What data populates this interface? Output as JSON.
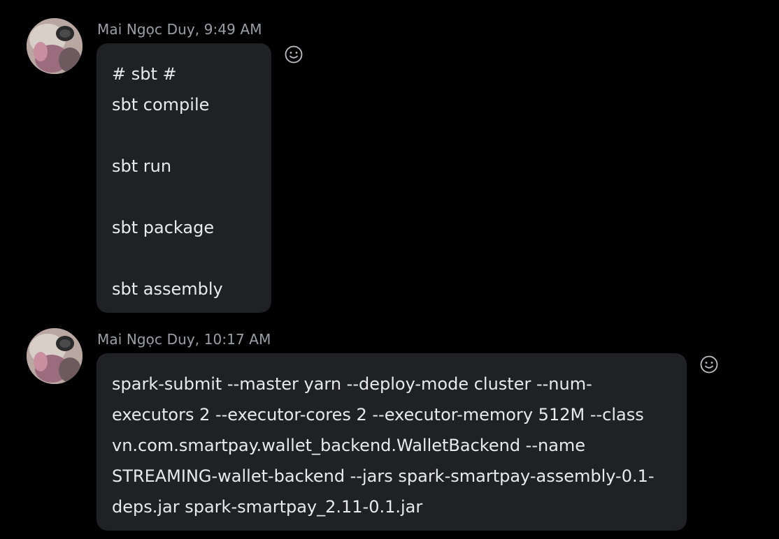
{
  "messages": [
    {
      "sender": "Mai Ngọc Duy",
      "time": "9:49 AM",
      "meta": "Mai Ngọc Duy, 9:49 AM",
      "lines": [
        "# sbt #",
        "sbt compile",
        "",
        "sbt run",
        "",
        "sbt package",
        "",
        "sbt assembly"
      ]
    },
    {
      "sender": "Mai Ngọc Duy",
      "time": "10:17 AM",
      "meta": "Mai Ngọc Duy, 10:17 AM",
      "lines": [
        "spark-submit --master yarn --deploy-mode cluster --num-",
        "executors 2 --executor-cores 2 --executor-memory 512M --class",
        "vn.com.smartpay.wallet_backend.WalletBackend --name",
        "STREAMING-wallet-backend --jars spark-smartpay-assembly-0.1-",
        "deps.jar spark-smartpay_2.11-0.1.jar"
      ]
    }
  ],
  "icons": {
    "reaction": "smiley-icon",
    "avatar": "avatar"
  },
  "colors": {
    "background": "#000000",
    "bubble": "#202124",
    "meta_text": "#9aa0a6",
    "message_text": "#e8eaed"
  }
}
